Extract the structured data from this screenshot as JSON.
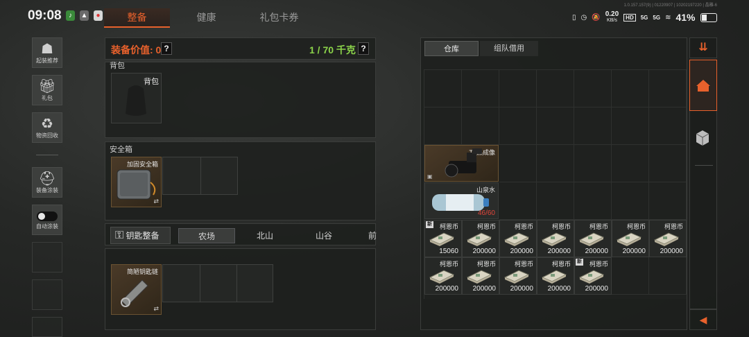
{
  "status_bar": {
    "time": "09:08",
    "speed_value": "0.20",
    "speed_unit": "KB/s",
    "hd_label": "HD",
    "signal_1": "5G",
    "signal_2": "5G",
    "battery": "41%",
    "battery_level": 0.41
  },
  "build_info": "1.0.157.157(9) | 01220907 | 10202197220 | 晶雕-6",
  "top_tabs": [
    {
      "label": "整备",
      "active": true
    },
    {
      "label": "健康",
      "active": false
    },
    {
      "label": "礼包卡券",
      "active": false
    }
  ],
  "left_sidebar": {
    "items": [
      {
        "label": "起装推荐",
        "icon": "soldier-loadout-icon"
      },
      {
        "label": "礼包",
        "icon": "gift-icon"
      },
      {
        "label": "物资回收",
        "icon": "recycle-icon"
      },
      {
        "label": "装备涂装",
        "icon": "paint-helmet-icon"
      },
      {
        "label": "自动涂装",
        "icon": "toggle-icon"
      }
    ]
  },
  "loadout": {
    "value_label": "装备价值: 0",
    "weight_label": "1 / 70 千克",
    "help_glyph": "?",
    "backpack_section": "背包",
    "backpack_slot_label": "背包",
    "safe_section": "安全箱",
    "safe_item_name": "加固安全箱",
    "swap_glyph": "⇄"
  },
  "key_section": {
    "button_label": "钥匙整备",
    "tabs": [
      {
        "label": "农场",
        "active": true
      },
      {
        "label": "北山",
        "active": false
      },
      {
        "label": "山谷",
        "active": false
      },
      {
        "label": "前",
        "active": false
      }
    ],
    "key_item_name": "简陋钥匙链"
  },
  "warehouse": {
    "tabs": [
      {
        "label": "仓库",
        "active": true
      },
      {
        "label": "组队借用",
        "active": false
      }
    ],
    "thermal_camera": {
      "name": "T7热成像"
    },
    "water": {
      "name": "山泉水",
      "count": "46/60"
    },
    "money_row_1": [
      {
        "name": "柯恩币",
        "count": "15060",
        "new": true
      },
      {
        "name": "柯恩币",
        "count": "200000",
        "new": false
      },
      {
        "name": "柯恩币",
        "count": "200000",
        "new": false
      },
      {
        "name": "柯恩币",
        "count": "200000",
        "new": false
      },
      {
        "name": "柯恩币",
        "count": "200000",
        "new": false
      },
      {
        "name": "柯恩币",
        "count": "200000",
        "new": false
      },
      {
        "name": "柯恩币",
        "count": "200000",
        "new": false
      }
    ],
    "money_row_2": [
      {
        "name": "柯恩币",
        "count": "200000",
        "new": false
      },
      {
        "name": "柯恩币",
        "count": "200000",
        "new": false
      },
      {
        "name": "柯恩币",
        "count": "200000",
        "new": false
      },
      {
        "name": "柯恩币",
        "count": "200000",
        "new": false
      },
      {
        "name": "柯恩币",
        "count": "200000",
        "new": true
      }
    ],
    "new_badge": "新"
  },
  "colors": {
    "accent": "#e8612c",
    "weight_green": "#8bd34a",
    "water_count_red": "#e0453a"
  },
  "right_sidebar_icons": [
    "sort-icon",
    "home-icon",
    "box-icon",
    "back-arrow-icon"
  ]
}
